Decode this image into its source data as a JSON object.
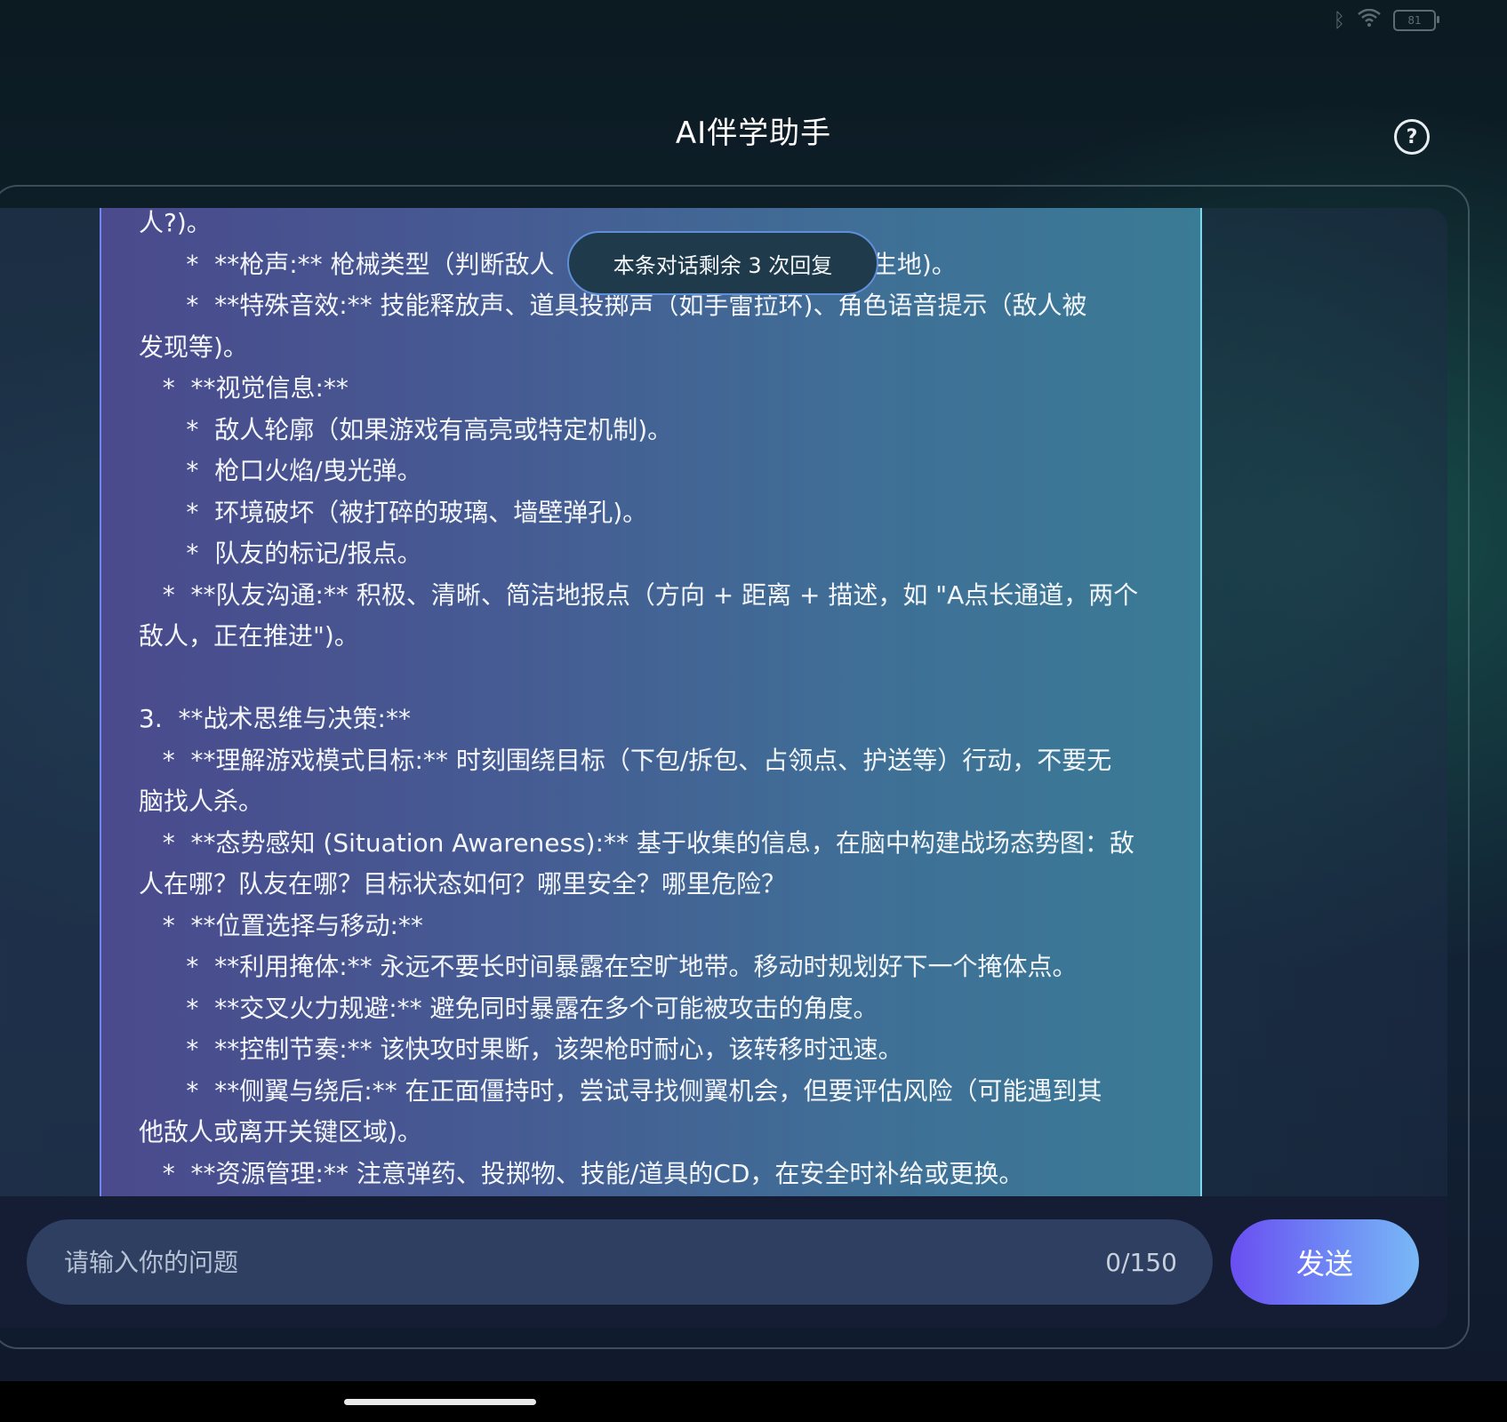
{
  "status_bar": {
    "bluetooth_icon": "bluetooth-icon",
    "wifi_icon": "wifi-icon",
    "battery_level": "81"
  },
  "header": {
    "title": "AI伴学助手",
    "help_icon": "help-icon",
    "help_glyph": "?"
  },
  "toast": {
    "text": "本条对话剩余 3 次回复"
  },
  "message": {
    "lines": [
      "人?)。",
      "      *  **枪声:** 枪械类型（判断敌人                                     发生地)。",
      "      *  **特殊音效:** 技能释放声、道具投掷声（如手雷拉环)、角色语音提示（敌人被",
      "发现等)。",
      "   *  **视觉信息:**",
      "      *  敌人轮廓（如果游戏有高亮或特定机制)。",
      "      *  枪口火焰/曳光弹。",
      "      *  环境破坏（被打碎的玻璃、墙壁弹孔)。",
      "      *  队友的标记/报点。",
      "   *  **队友沟通:** 积极、清晰、简洁地报点（方向 + 距离 + 描述，如 \"A点长通道，两个",
      "敌人，正在推进\")。",
      "",
      "3.  **战术思维与决策:**",
      "   *  **理解游戏模式目标:** 时刻围绕目标（下包/拆包、占领点、护送等）行动，不要无",
      "脑找人杀。",
      "   *  **态势感知 (Situation Awareness):** 基于收集的信息，在脑中构建战场态势图：敌",
      "人在哪？队友在哪？目标状态如何？哪里安全？哪里危险？",
      "   *  **位置选择与移动:**",
      "      *  **利用掩体:** 永远不要长时间暴露在空旷地带。移动时规划好下一个掩体点。",
      "      *  **交叉火力规避:** 避免同时暴露在多个可能被攻击的角度。",
      "      *  **控制节奏:** 该快攻时果断，该架枪时耐心，该转移时迅速。",
      "      *  **侧翼与绕后:** 在正面僵持时，尝试寻找侧翼机会，但要评估风险（可能遇到其",
      "他敌人或离开关键区域)。",
      "   *  **资源管理:** 注意弹药、投掷物、技能/道具的CD，在安全时补给或更换。"
    ]
  },
  "composer": {
    "placeholder": "请输入你的问题",
    "value": "",
    "counter": "0/150",
    "send_label": "发送"
  }
}
